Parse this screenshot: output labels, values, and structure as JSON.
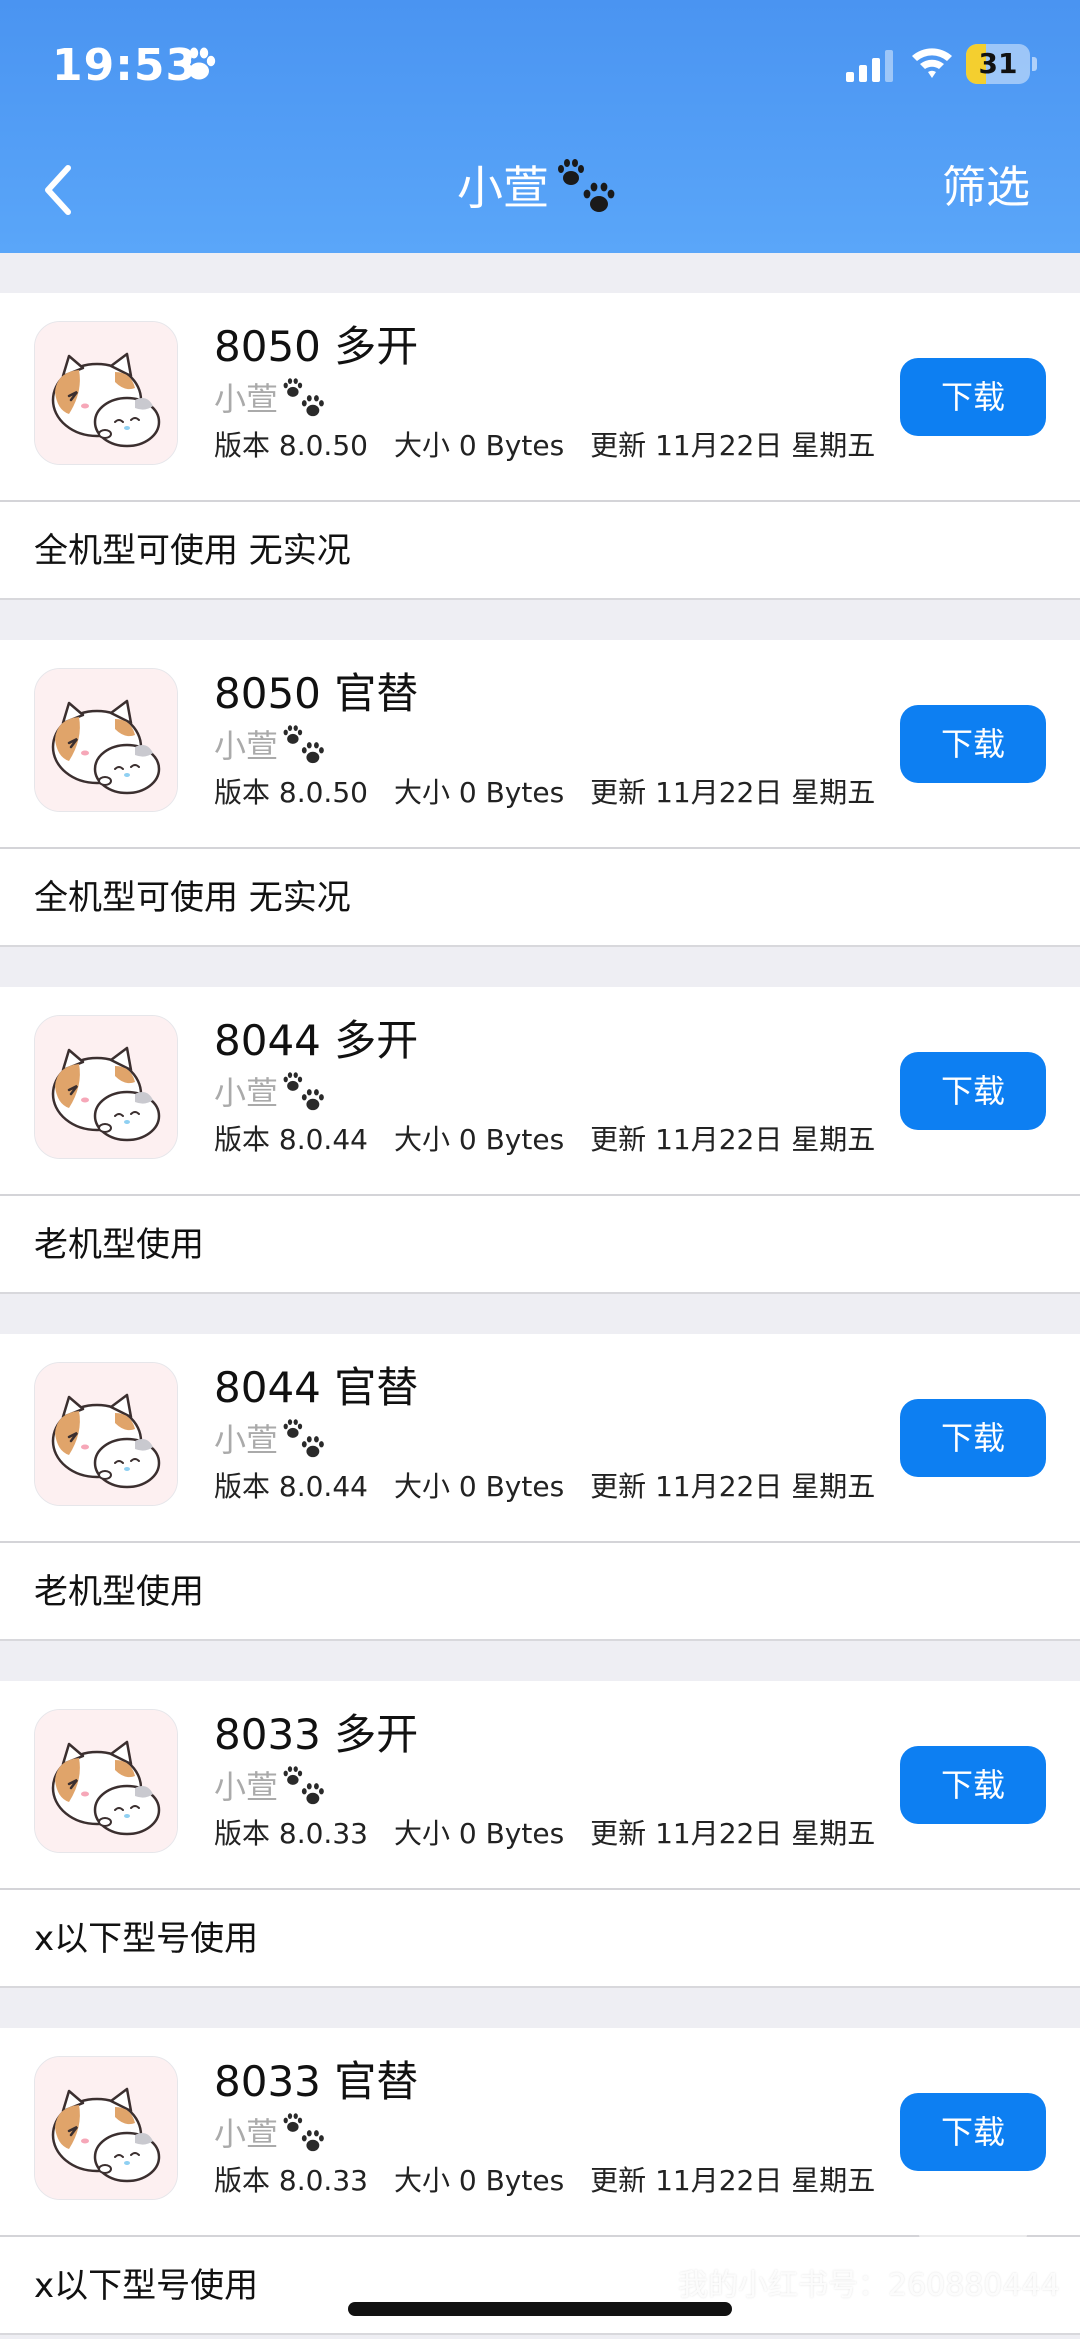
{
  "status_bar": {
    "time": "19:53",
    "battery_level": "31",
    "battery_fraction": 0.31
  },
  "nav": {
    "title": "小萱",
    "filter_label": "筛选"
  },
  "items": [
    {
      "name": "8050 多开",
      "developer": "小萱",
      "version": "版本 8.0.50",
      "size": "大小 0 Bytes",
      "updated": "更新 11月22日 星期五",
      "download_label": "下载",
      "note": "全机型可使用 无实况"
    },
    {
      "name": "8050 官替",
      "developer": "小萱",
      "version": "版本 8.0.50",
      "size": "大小 0 Bytes",
      "updated": "更新 11月22日 星期五",
      "download_label": "下载",
      "note": "全机型可使用 无实况"
    },
    {
      "name": "8044 多开",
      "developer": "小萱",
      "version": "版本 8.0.44",
      "size": "大小 0 Bytes",
      "updated": "更新 11月22日 星期五",
      "download_label": "下载",
      "note": "老机型使用"
    },
    {
      "name": "8044 官替",
      "developer": "小萱",
      "version": "版本 8.0.44",
      "size": "大小 0 Bytes",
      "updated": "更新 11月22日 星期五",
      "download_label": "下载",
      "note": "老机型使用"
    },
    {
      "name": "8033 多开",
      "developer": "小萱",
      "version": "版本 8.0.33",
      "size": "大小 0 Bytes",
      "updated": "更新 11月22日 星期五",
      "download_label": "下载",
      "note": "x以下型号使用"
    },
    {
      "name": "8033 官替",
      "developer": "小萱",
      "version": "版本 8.0.33",
      "size": "大小 0 Bytes",
      "updated": "更新 11月22日 星期五",
      "download_label": "下载",
      "note": "x以下型号使用"
    }
  ],
  "watermark": {
    "text": "我的小红书号：260880444"
  },
  "colors": {
    "header": "#4a94f1",
    "download_button": "#0d7ff2",
    "battery": "#f4cf2f"
  }
}
